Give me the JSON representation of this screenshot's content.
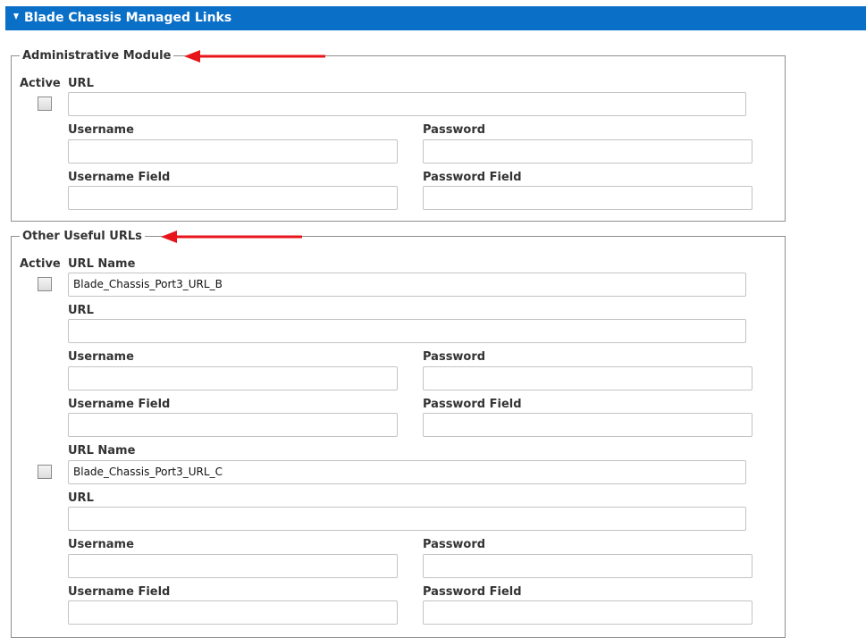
{
  "header": {
    "title": "Blade Chassis Managed Links"
  },
  "admin_module": {
    "legend": "Administrative Module",
    "active_label": "Active",
    "url_label": "URL",
    "url_value": "",
    "username_label": "Username",
    "username_value": "",
    "password_label": "Password",
    "password_value": "",
    "username_field_label": "Username Field",
    "username_field_value": "",
    "password_field_label": "Password Field",
    "password_field_value": ""
  },
  "other_urls": {
    "legend": "Other Useful URLs",
    "active_label": "Active",
    "entries": [
      {
        "url_name_label": "URL Name",
        "url_name_value": "Blade_Chassis_Port3_URL_B",
        "url_label": "URL",
        "url_value": "",
        "username_label": "Username",
        "username_value": "",
        "password_label": "Password",
        "password_value": "",
        "username_field_label": "Username Field",
        "username_field_value": "",
        "password_field_label": "Password Field",
        "password_field_value": ""
      },
      {
        "url_name_label": "URL Name",
        "url_name_value": "Blade_Chassis_Port3_URL_C",
        "url_label": "URL",
        "url_value": "",
        "username_label": "Username",
        "username_value": "",
        "password_label": "Password",
        "password_value": "",
        "username_field_label": "Username Field",
        "username_field_value": "",
        "password_field_label": "Password Field",
        "password_field_value": ""
      }
    ]
  },
  "colors": {
    "header_bg": "#0a6fc7",
    "arrow": "#e8141c",
    "border": "#8e8e8e"
  },
  "icons": {
    "header_toggle": "triangle-down-icon",
    "annotation": "red-arrow-icon"
  }
}
